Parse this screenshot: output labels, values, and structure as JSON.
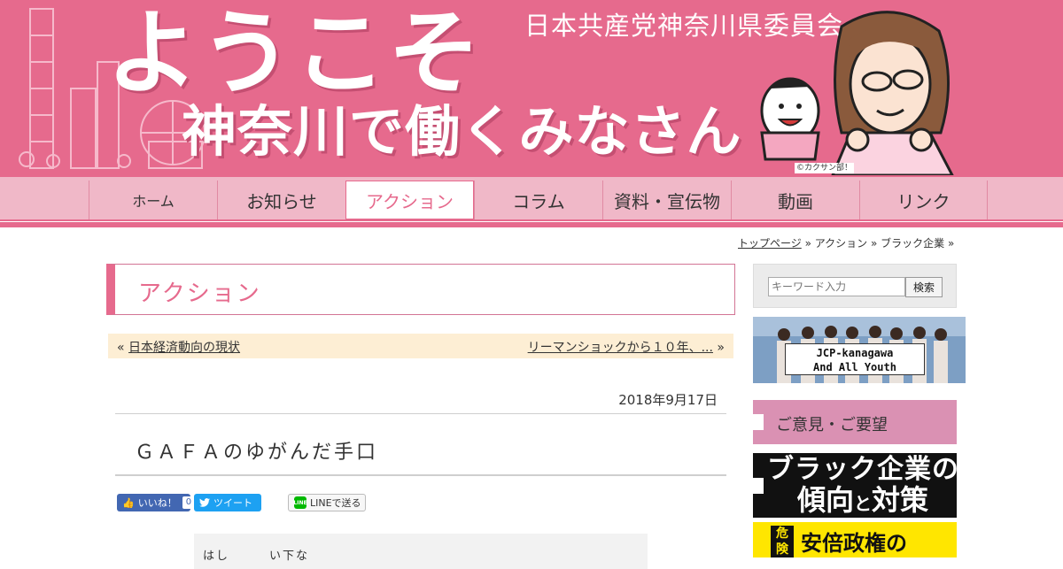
{
  "header": {
    "welcome": "ようこそ",
    "subtitle": "神奈川で働くみなさん",
    "organization": "日本共産党神奈川県委員会",
    "copyright": "©カクサン部！"
  },
  "nav": {
    "items": [
      {
        "label": "ホーム",
        "active": false
      },
      {
        "label": "お知らせ",
        "active": false
      },
      {
        "label": "アクション",
        "active": true
      },
      {
        "label": "コラム",
        "active": false
      },
      {
        "label": "資料・宣伝物",
        "active": false
      },
      {
        "label": "動画",
        "active": false
      },
      {
        "label": "リンク",
        "active": false
      }
    ]
  },
  "breadcrumb": {
    "top": "トップページ",
    "sep": "»",
    "action": "アクション",
    "current": "ブラック企業"
  },
  "main": {
    "section_title": "アクション",
    "pager": {
      "prev_arrow": "«",
      "prev_label": "日本経済動向の現状",
      "next_label": "リーマンショックから１０年、...",
      "next_arrow": "»"
    },
    "post": {
      "date": "2018年9月17日",
      "title": "ＧＡＦＡのゆがんだ手口"
    },
    "share": {
      "like_label": "いいね！",
      "like_count": "0",
      "tweet_label": "ツイート",
      "line_label": "LINEで送る",
      "line_badge": "LINE"
    },
    "article_image_text": "はし　　　い下な　　　　　　　　　　　　　　　　　　　　　　　　　"
  },
  "sidebar": {
    "search_placeholder": "キーワード入力",
    "search_button": "検索",
    "youth_line1": "JCP-kanagawa",
    "youth_line2": "And All Youth",
    "opinion": "ご意見・ご要望",
    "black_line1": "ブラック企業の",
    "black_line2a": "傾向",
    "black_line2b": "と",
    "black_line2c": "対策",
    "danger": "危険",
    "yellow_text": "安倍政権の"
  },
  "colors": {
    "brand_pink": "#e66a8d",
    "nav_pink": "#f0b8c8",
    "pager_bg": "#fdeed4"
  }
}
